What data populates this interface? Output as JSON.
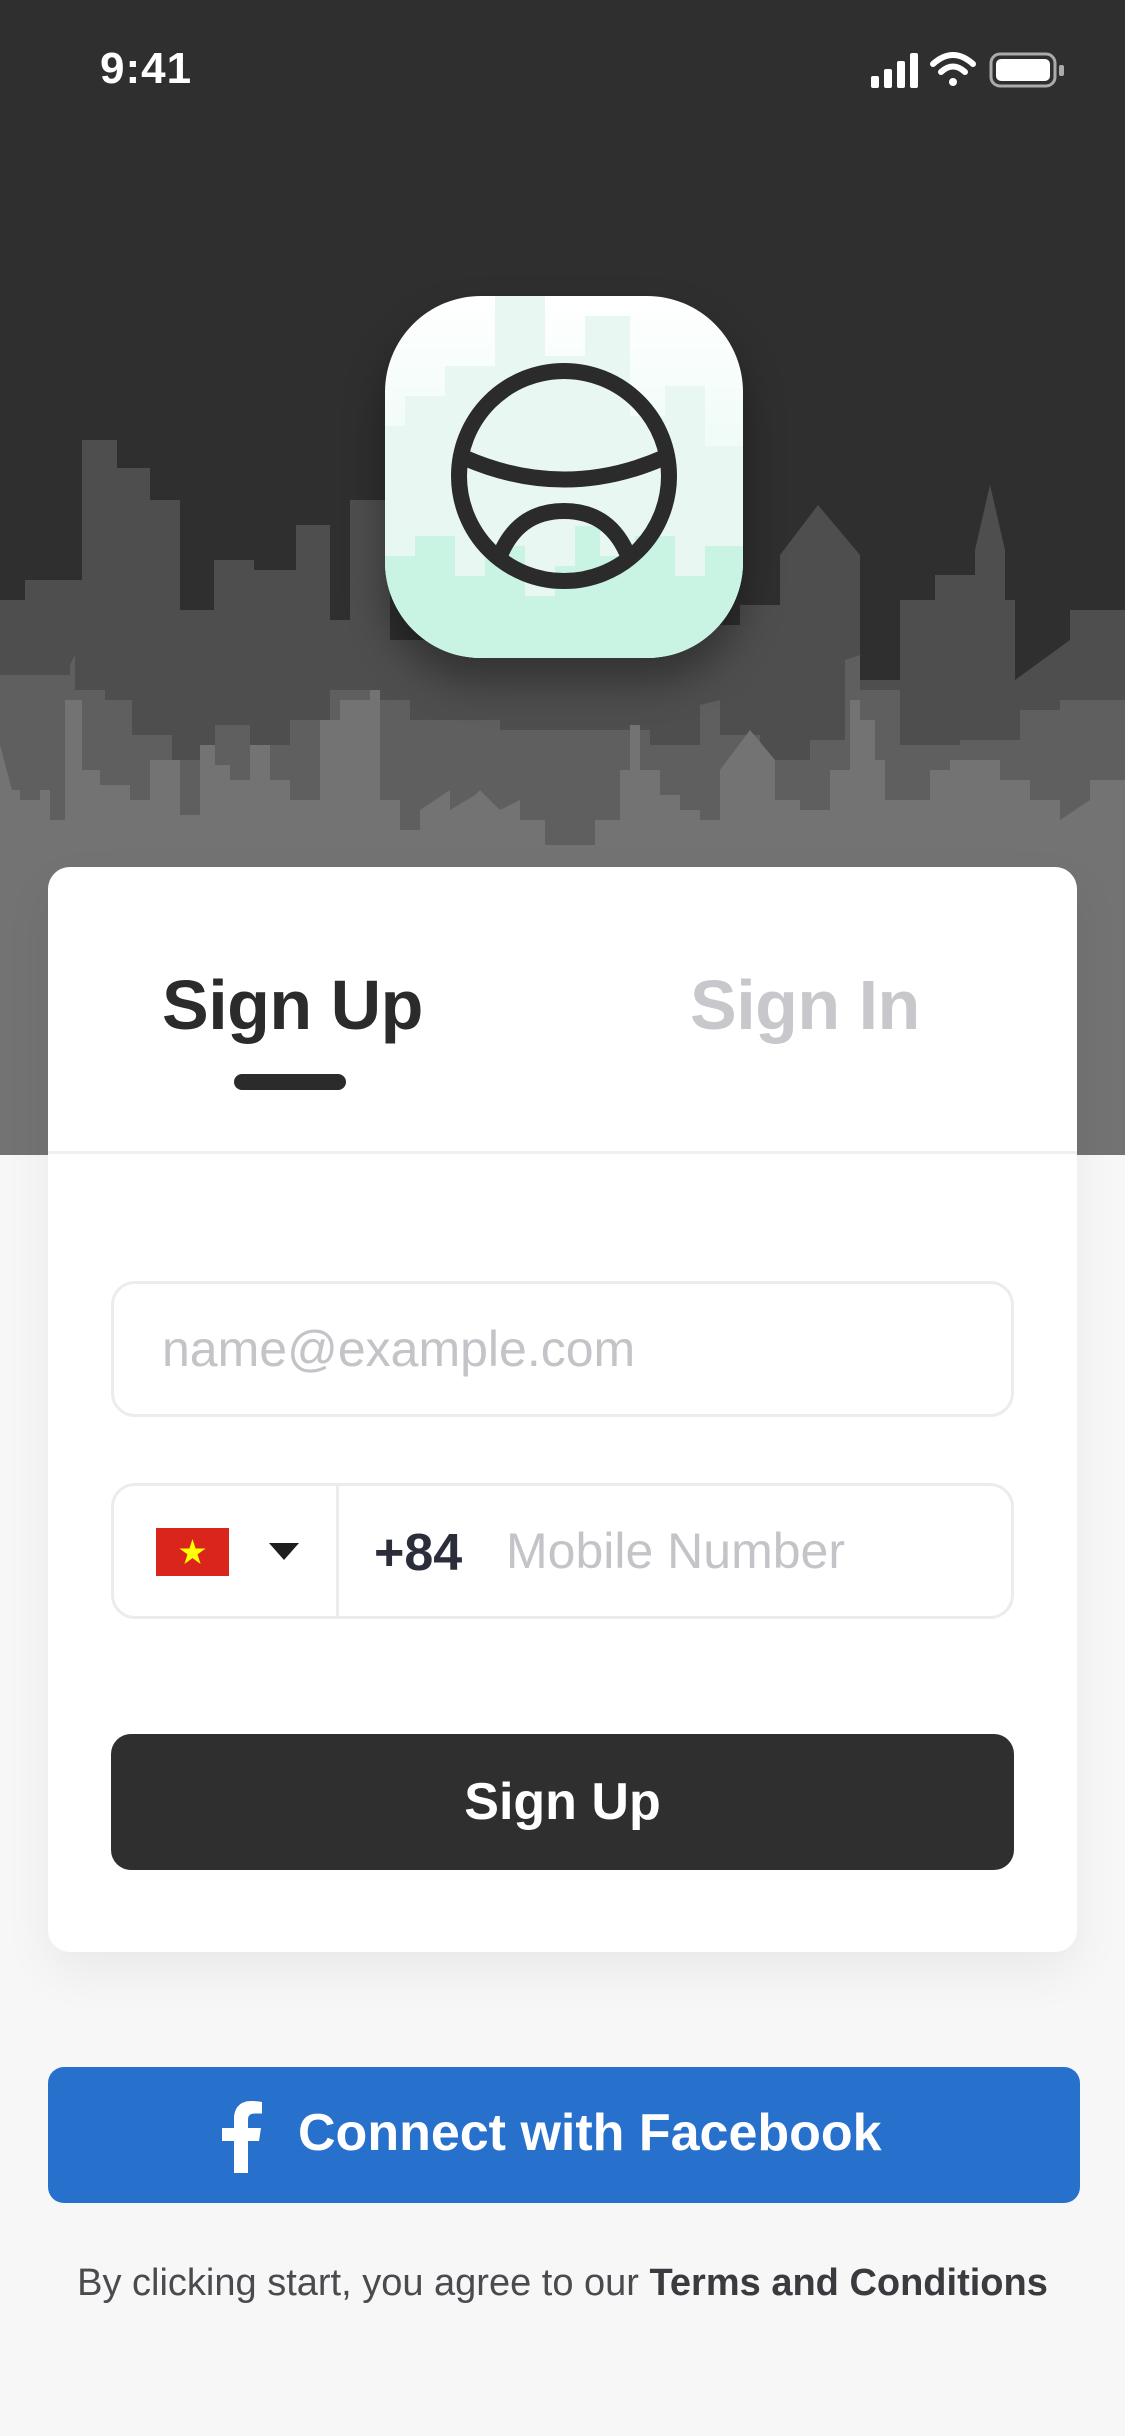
{
  "status_bar": {
    "time": "9:41"
  },
  "tabs": {
    "signup_label": "Sign Up",
    "signin_label": "Sign In",
    "active": "signup"
  },
  "form": {
    "email": {
      "placeholder": "name@example.com",
      "value": ""
    },
    "phone": {
      "country_flag": "vietnam-flag",
      "dial_code": "+84",
      "placeholder": "Mobile Number",
      "value": ""
    },
    "submit_label": "Sign Up"
  },
  "facebook": {
    "label": "Connect with Facebook",
    "icon": "facebook-icon"
  },
  "terms": {
    "prefix": "By clicking start, you agree to our",
    "link_label": "Terms and Conditions"
  },
  "colors": {
    "dark": "#2f2f2f",
    "facebook_blue": "#2771cc",
    "placeholder": "#c3c3c8",
    "icon_mint": "#bff3df"
  }
}
